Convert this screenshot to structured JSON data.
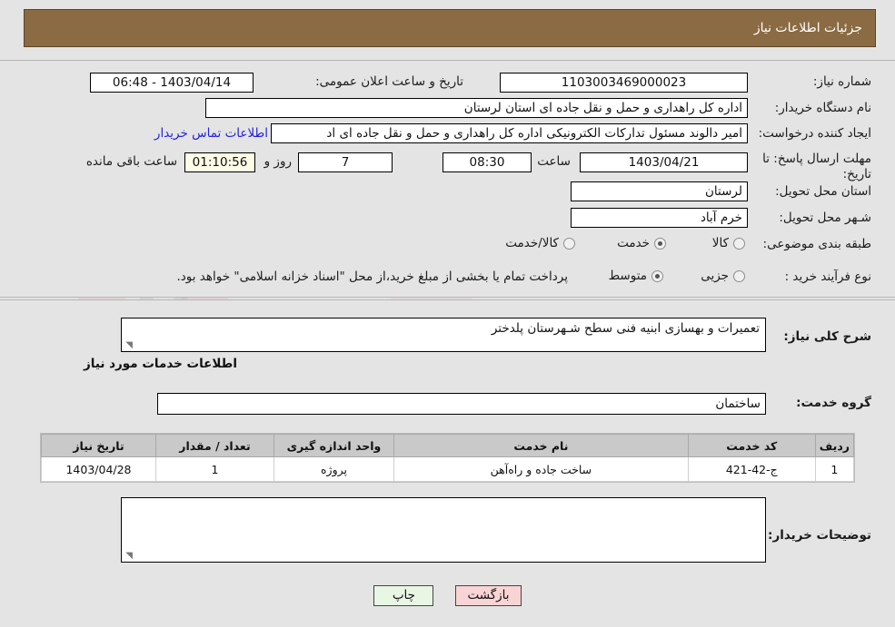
{
  "header": {
    "title": "جزئیات اطلاعات نیاز"
  },
  "top_section": {
    "need_number": {
      "label": "شماره نیاز:",
      "value": "1103003469000023"
    },
    "announce_datetime": {
      "label": "تاریخ و ساعت اعلان عمومی:",
      "value": "1403/04/14 - 06:48"
    },
    "buyer_org": {
      "label": "نام دستگاه خریدار:",
      "value": "اداره کل راهداری و حمل و نقل جاده ای استان لرستان"
    },
    "request_creator": {
      "label": "ایجاد کننده درخواست:",
      "value": "امیر دالوند مسئول تدارکات الکترونیکی  اداره کل راهداری و حمل و نقل جاده ای اد",
      "contact_link": "اطلاعات تماس خریدار"
    },
    "reply_deadline": {
      "label_line1": "مهلت ارسال پاسخ: تا",
      "label_line2": "تاریخ:",
      "date": "1403/04/21",
      "time_label": "ساعت",
      "time": "08:30",
      "days": "7",
      "days_label": "روز و",
      "countdown": "01:10:56",
      "countdown_label": "ساعت باقی مانده"
    },
    "delivery_province": {
      "label": "استان محل تحویل:",
      "value": "لرستان"
    },
    "delivery_city": {
      "label": "شـهر محل تحویل:",
      "value": "خرم آباد"
    },
    "category": {
      "label": "طبقه بندی موضوعی:",
      "options": [
        "کالا",
        "خدمت",
        "کالا/خدمت"
      ],
      "selected": "خدمت"
    },
    "purchase_process": {
      "label": "نوع فرآیند خرید :",
      "options": [
        "جزیی",
        "متوسط"
      ],
      "selected": "متوسط",
      "note": "پرداخت تمام یا بخشی از مبلغ خرید،از محل \"اسناد خزانه اسلامی\" خواهد بود."
    }
  },
  "bottom_section": {
    "need_description": {
      "label": "شرح کلی نیاز:",
      "value": "تعمیرات و بهسازی ابنیه فنی سطح شـهرستان پلدختر"
    },
    "services_heading": "اطلاعات خدمات مورد نیاز",
    "service_group": {
      "label": "گروه خدمت:",
      "value": "ساختمان"
    },
    "table": {
      "columns": [
        "ردیف",
        "کد خدمت",
        "نام خدمت",
        "واحد اندازه گیری",
        "تعداد / مقدار",
        "تاریخ نیاز"
      ],
      "rows": [
        {
          "row_no": "1",
          "service_code": "ج-42-421",
          "service_name": "ساخت جاده و راه‌آهن",
          "unit": "پروژه",
          "quantity": "1",
          "need_date": "1403/04/28"
        }
      ]
    },
    "buyer_notes": {
      "label": "توضیحات خریدار:",
      "value": ""
    }
  },
  "footer": {
    "back_button": "بازگشت",
    "print_button": "چاپ"
  },
  "watermark": {
    "text": "AnaTender.net"
  },
  "colors": {
    "header_bar": "#8b6b43",
    "page_bg": "#e4e4e4",
    "link": "#2222dd",
    "back_btn": "#f9d4d4",
    "print_btn": "#e8f6e4",
    "countdown_bg": "#fbfbe6",
    "table_header": "#c9c9c9"
  }
}
